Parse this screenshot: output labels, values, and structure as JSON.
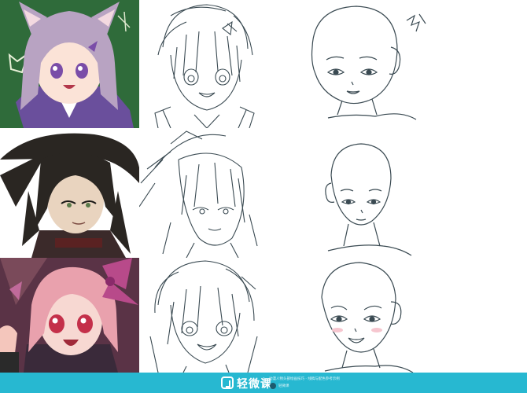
{
  "footer": {
    "brand": "轻微课",
    "caption": "动漫人物头部绘画技巧 · 线稿与配色参考示例",
    "user": "轻微课"
  },
  "colors": {
    "footer_bar": "#27b8d1",
    "chalkboard": "#2f6b3a",
    "lavender_hair": "#b8a3c2",
    "dark_hair": "#2a2622",
    "pink_hair": "#e9a1ad",
    "sketch_line": "#3a4a52"
  },
  "rows": [
    {
      "color_art": "cat-ear-girl-illustration",
      "sketch": "cat-ear-girl-sketch",
      "base": "head-base-three-quarter"
    },
    {
      "color_art": "long-dark-hair-boy-illustration",
      "sketch": "long-hair-boy-sketch",
      "base": "head-base-front"
    },
    {
      "color_art": "pink-bow-girl-illustration",
      "sketch": "short-hair-girl-sketch",
      "base": "head-base-blushing"
    }
  ]
}
